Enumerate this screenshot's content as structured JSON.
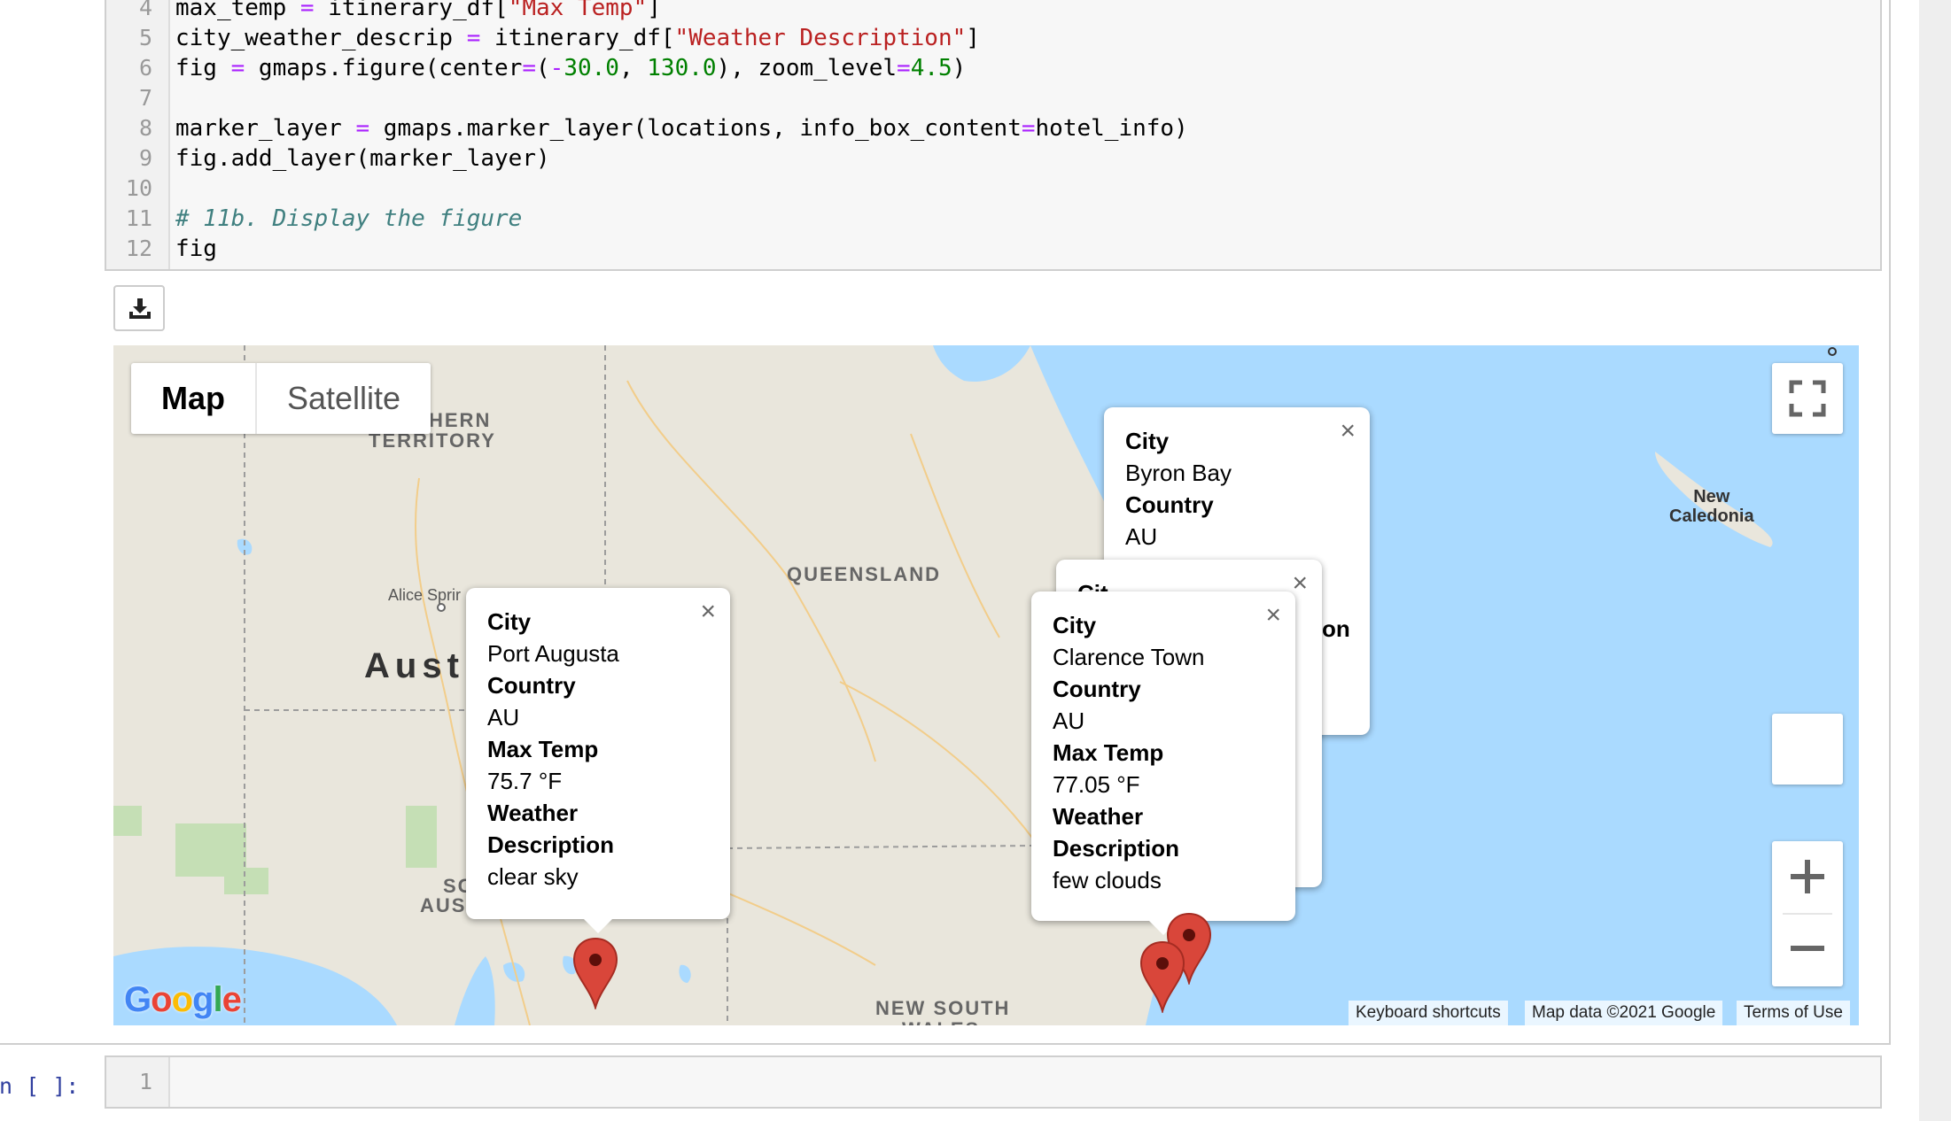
{
  "code_cell": {
    "lines": [
      {
        "n": "4",
        "tokens": [
          [
            "max_temp ",
            ""
          ],
          [
            "=",
            "op"
          ],
          [
            " itinerary_df[",
            ""
          ],
          [
            "\"Max Temp\"",
            "str"
          ],
          [
            "]",
            ""
          ]
        ]
      },
      {
        "n": "5",
        "tokens": [
          [
            "city_weather_descrip ",
            ""
          ],
          [
            "=",
            "op"
          ],
          [
            " itinerary_df[",
            ""
          ],
          [
            "\"Weather Description\"",
            "str"
          ],
          [
            "]",
            ""
          ]
        ]
      },
      {
        "n": "6",
        "tokens": [
          [
            "fig ",
            ""
          ],
          [
            "=",
            "op"
          ],
          [
            " gmaps.figure(center",
            ""
          ],
          [
            "=",
            "op"
          ],
          [
            "(",
            ""
          ],
          [
            "-",
            "op"
          ],
          [
            "30.0",
            "num"
          ],
          [
            ", ",
            ""
          ],
          [
            "130.0",
            "num"
          ],
          [
            "), zoom_level",
            ""
          ],
          [
            "=",
            "op"
          ],
          [
            "4.5",
            "num"
          ],
          [
            ")",
            ""
          ]
        ]
      },
      {
        "n": "7",
        "tokens": []
      },
      {
        "n": "8",
        "tokens": [
          [
            "marker_layer ",
            ""
          ],
          [
            "=",
            "op"
          ],
          [
            " gmaps.marker_layer(locations, info_box_content",
            ""
          ],
          [
            "=",
            "op"
          ],
          [
            "hotel_info)",
            ""
          ]
        ]
      },
      {
        "n": "9",
        "tokens": [
          [
            "fig.add_layer(marker_layer)",
            ""
          ]
        ]
      },
      {
        "n": "10",
        "tokens": []
      },
      {
        "n": "11",
        "tokens": [
          [
            "# 11b. Display the figure",
            "com"
          ]
        ]
      },
      {
        "n": "12",
        "tokens": [
          [
            "fig",
            ""
          ]
        ]
      }
    ]
  },
  "download_icon": "download-tray-icon",
  "map": {
    "type_control": {
      "map_label": "Map",
      "satellite_label": "Satellite"
    },
    "labels": {
      "northern_territory_line1": "HERN",
      "northern_territory_line2": "TERRITORY",
      "queensland": "QUEENSLAND",
      "australia": "Austr",
      "alice_springs": "Alice Sprir",
      "south_aus_line1": "SC",
      "south_aus_line2": "AUS",
      "new_south_wales_line1": "NEW SOUTH",
      "new_south_wales_line2": "WALES",
      "new_caledonia_line1": "New",
      "new_caledonia_line2": "Caledonia"
    },
    "info_windows": {
      "byron_bay": {
        "k_city": "City",
        "city": "Byron Bay",
        "k_country": "Country",
        "country": "AU",
        "fragment": "on"
      },
      "middle": {
        "fragment": "Cit"
      },
      "port_augusta": {
        "k_city": "City",
        "city": "Port Augusta",
        "k_country": "Country",
        "country": "AU",
        "k_temp": "Max Temp",
        "temp": "75.7 °F",
        "k_desc": "Weather Description",
        "desc": "clear sky"
      },
      "clarence_town": {
        "k_city": "City",
        "city": "Clarence Town",
        "k_country": "Country",
        "country": "AU",
        "k_temp": "Max Temp",
        "temp": "77.05 °F",
        "k_desc": "Weather Description",
        "desc": "few clouds"
      }
    },
    "close_glyph": "×",
    "attribution": {
      "keyboard": "Keyboard shortcuts",
      "map_data": "Map data ©2021 Google",
      "terms": "Terms of Use"
    },
    "logo": {
      "letters": [
        "G",
        "o",
        "o",
        "g",
        "l",
        "e"
      ],
      "colors": [
        "#4285f4",
        "#ea4335",
        "#fbbc05",
        "#4285f4",
        "#34a853",
        "#ea4335"
      ]
    },
    "colors": {
      "land": "#e9e6dc",
      "water": "#aadaff",
      "park": "#c5dfb5",
      "marker": "#d9463a"
    }
  },
  "empty_cell": {
    "prompt": "In [ ]:",
    "line_number": "1"
  }
}
